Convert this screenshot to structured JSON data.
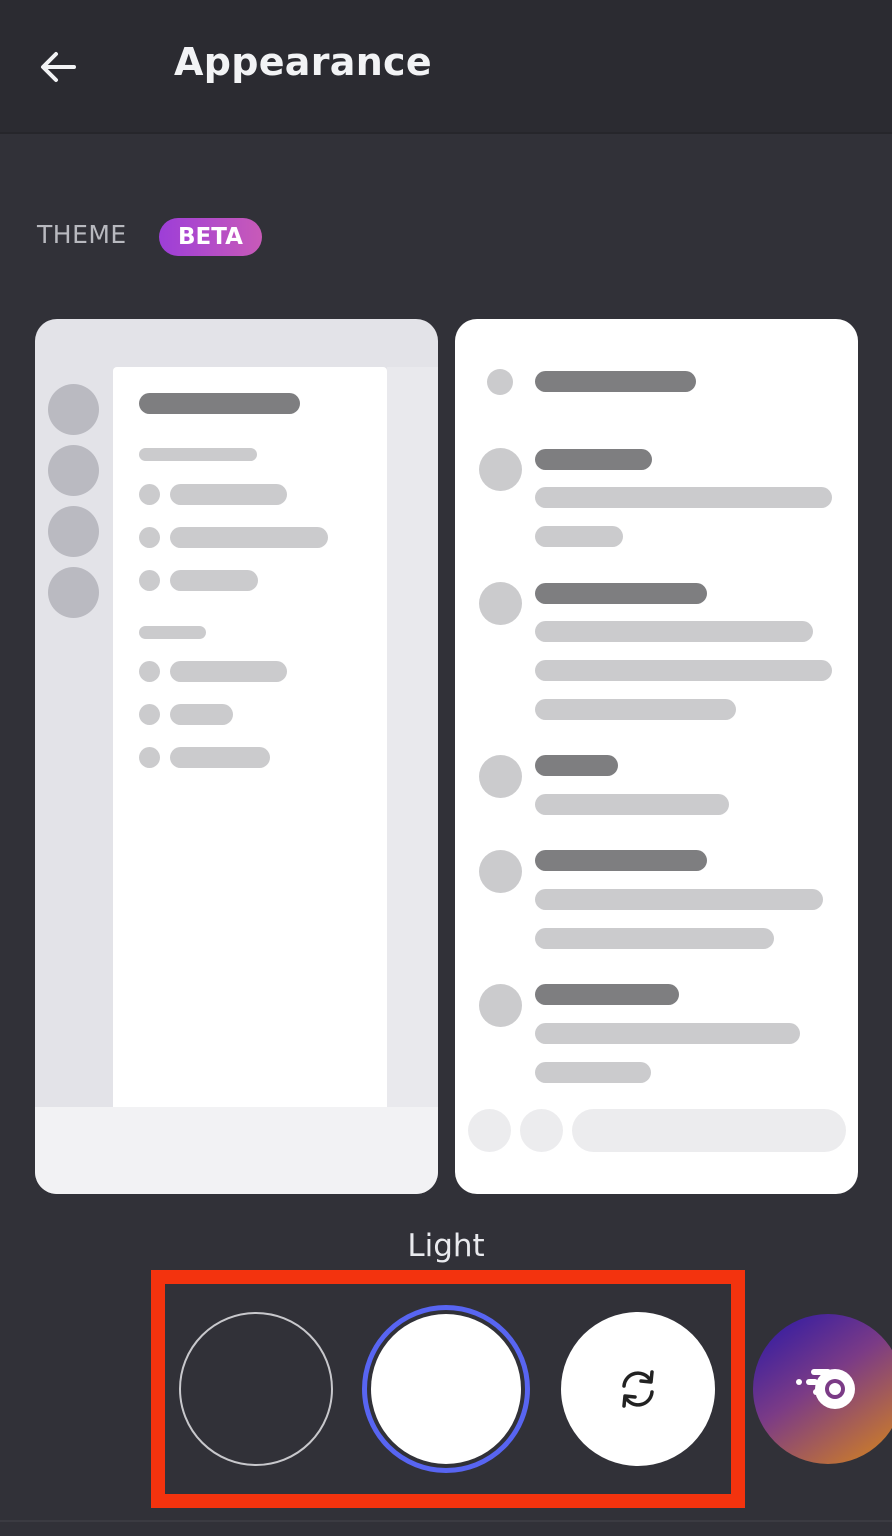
{
  "header": {
    "back_icon": "arrow-left-icon",
    "title": "Appearance"
  },
  "theme_section": {
    "label": "THEME",
    "badge": "BETA",
    "badge_gradient": [
      "#9d3ed8",
      "#c85ab8"
    ]
  },
  "preview": {
    "left_card": "light-theme-guild-list-preview",
    "right_card": "light-theme-chat-preview"
  },
  "selected_theme_label": "Light",
  "theme_options": [
    {
      "name": "Dark",
      "selected": false,
      "icon": null
    },
    {
      "name": "Light",
      "selected": true,
      "icon": null
    },
    {
      "name": "Sync with computer",
      "selected": false,
      "icon": "sync-icon"
    },
    {
      "name": "Nitro themes",
      "selected": false,
      "icon": "nitro-icon"
    }
  ],
  "colors": {
    "background": "#313138",
    "header": "#2b2b31",
    "selected_ring": "#5865f2",
    "highlight_box": "#f3330e"
  }
}
